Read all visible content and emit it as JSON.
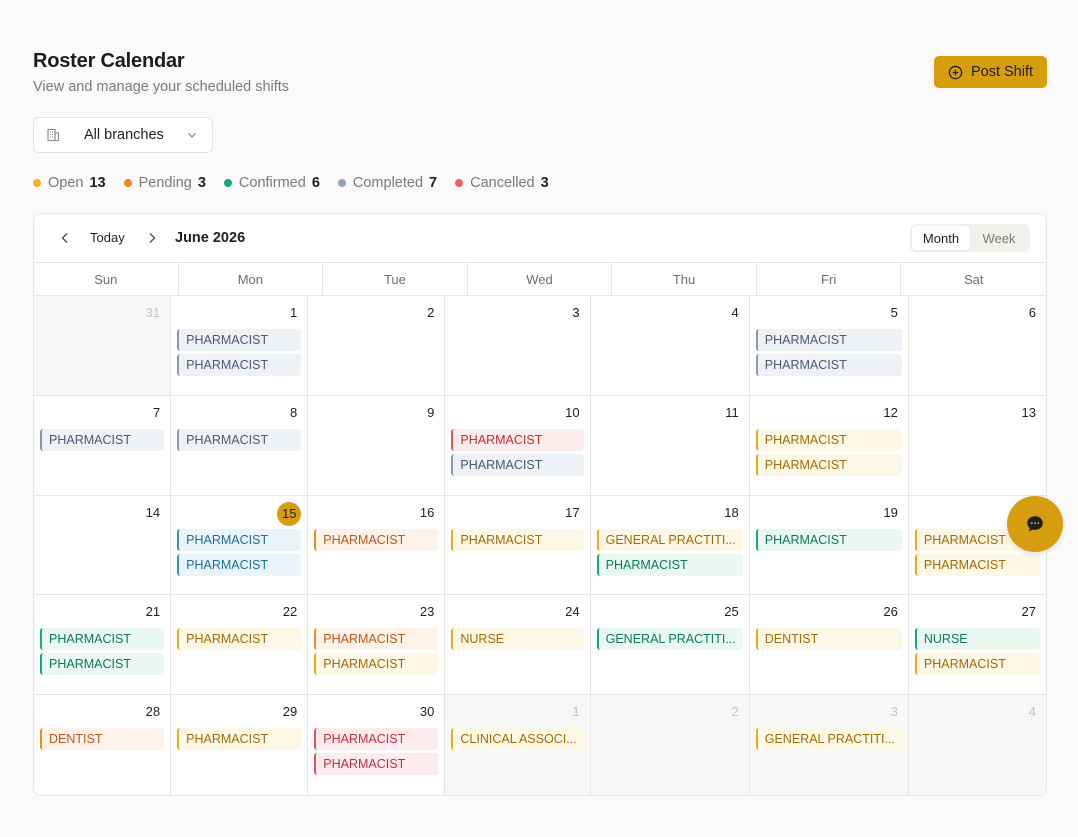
{
  "header": {
    "title": "Roster Calendar",
    "subtitle": "View and manage your scheduled shifts",
    "post_shift_label": "Post Shift"
  },
  "branch_filter": {
    "selected": "All branches"
  },
  "stats": [
    {
      "label": "Open",
      "count": "13",
      "color": "#f4b322"
    },
    {
      "label": "Pending",
      "count": "3",
      "color": "#ef8a25"
    },
    {
      "label": "Confirmed",
      "count": "6",
      "color": "#1aa877"
    },
    {
      "label": "Completed",
      "count": "7",
      "color": "#94a3b8"
    },
    {
      "label": "Cancelled",
      "count": "3",
      "color": "#ef5d6a"
    }
  ],
  "toolbar": {
    "today_label": "Today",
    "month_label": "June 2026",
    "view_month": "Month",
    "view_week": "Week",
    "active_view": "Month"
  },
  "weekdays": [
    "Sun",
    "Mon",
    "Tue",
    "Wed",
    "Thu",
    "Fri",
    "Sat"
  ],
  "days": [
    {
      "day": "31",
      "muted": true,
      "shifts": []
    },
    {
      "day": "1",
      "shifts": [
        {
          "label": "PHARMACIST",
          "status": "gray"
        },
        {
          "label": "PHARMACIST",
          "status": "gray"
        }
      ]
    },
    {
      "day": "2",
      "shifts": []
    },
    {
      "day": "3",
      "shifts": []
    },
    {
      "day": "4",
      "shifts": []
    },
    {
      "day": "5",
      "shifts": [
        {
          "label": "PHARMACIST",
          "status": "gray"
        },
        {
          "label": "PHARMACIST",
          "status": "gray"
        }
      ]
    },
    {
      "day": "6",
      "shifts": []
    },
    {
      "day": "7",
      "shifts": [
        {
          "label": "PHARMACIST",
          "status": "gray"
        }
      ]
    },
    {
      "day": "8",
      "shifts": [
        {
          "label": "PHARMACIST",
          "status": "gray"
        }
      ]
    },
    {
      "day": "9",
      "shifts": []
    },
    {
      "day": "10",
      "shifts": [
        {
          "label": "PHARMACIST",
          "status": "red"
        },
        {
          "label": "PHARMACIST",
          "status": "gray"
        }
      ]
    },
    {
      "day": "11",
      "shifts": []
    },
    {
      "day": "12",
      "shifts": [
        {
          "label": "PHARMACIST",
          "status": "amber"
        },
        {
          "label": "PHARMACIST",
          "status": "amber"
        }
      ]
    },
    {
      "day": "13",
      "shifts": []
    },
    {
      "day": "14",
      "shifts": []
    },
    {
      "day": "15",
      "today": true,
      "shifts": [
        {
          "label": "PHARMACIST",
          "status": "blue"
        },
        {
          "label": "PHARMACIST",
          "status": "blue"
        }
      ]
    },
    {
      "day": "16",
      "shifts": [
        {
          "label": "PHARMACIST",
          "status": "orange"
        }
      ]
    },
    {
      "day": "17",
      "shifts": [
        {
          "label": "PHARMACIST",
          "status": "amber"
        }
      ]
    },
    {
      "day": "18",
      "shifts": [
        {
          "label": "GENERAL PRACTITI...",
          "status": "amber"
        },
        {
          "label": "PHARMACIST",
          "status": "green"
        }
      ]
    },
    {
      "day": "19",
      "shifts": [
        {
          "label": "PHARMACIST",
          "status": "green"
        }
      ]
    },
    {
      "day": "20",
      "shifts": [
        {
          "label": "PHARMACIST",
          "status": "amber"
        },
        {
          "label": "PHARMACIST",
          "status": "amber"
        }
      ]
    },
    {
      "day": "21",
      "shifts": [
        {
          "label": "PHARMACIST",
          "status": "green"
        },
        {
          "label": "PHARMACIST",
          "status": "green"
        }
      ]
    },
    {
      "day": "22",
      "shifts": [
        {
          "label": "PHARMACIST",
          "status": "amber"
        }
      ]
    },
    {
      "day": "23",
      "shifts": [
        {
          "label": "PHARMACIST",
          "status": "orange"
        },
        {
          "label": "PHARMACIST",
          "status": "amber"
        }
      ]
    },
    {
      "day": "24",
      "shifts": [
        {
          "label": "NURSE",
          "status": "amber"
        }
      ]
    },
    {
      "day": "25",
      "shifts": [
        {
          "label": "GENERAL PRACTITI...",
          "status": "green"
        }
      ]
    },
    {
      "day": "26",
      "shifts": [
        {
          "label": "DENTIST",
          "status": "amber"
        }
      ]
    },
    {
      "day": "27",
      "shifts": [
        {
          "label": "NURSE",
          "status": "green"
        },
        {
          "label": "PHARMACIST",
          "status": "amber"
        }
      ]
    },
    {
      "day": "28",
      "shifts": [
        {
          "label": "DENTIST",
          "status": "orange"
        }
      ]
    },
    {
      "day": "29",
      "shifts": [
        {
          "label": "PHARMACIST",
          "status": "amber"
        }
      ]
    },
    {
      "day": "30",
      "shifts": [
        {
          "label": "PHARMACIST",
          "status": "red"
        },
        {
          "label": "PHARMACIST",
          "status": "red"
        }
      ]
    },
    {
      "day": "1",
      "muted": true,
      "shifts": [
        {
          "label": "CLINICAL ASSOCI...",
          "status": "amber"
        }
      ]
    },
    {
      "day": "2",
      "muted": true,
      "shifts": []
    },
    {
      "day": "3",
      "muted": true,
      "shifts": [
        {
          "label": "GENERAL PRACTITI...",
          "status": "amber"
        }
      ]
    },
    {
      "day": "4",
      "muted": true,
      "shifts": []
    }
  ]
}
